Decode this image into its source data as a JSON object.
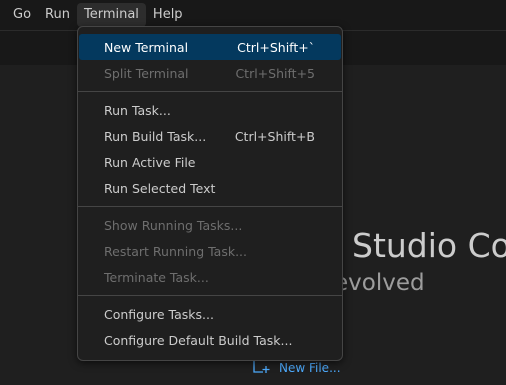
{
  "menubar": {
    "items": [
      {
        "label": "Go",
        "active": false
      },
      {
        "label": "Run",
        "active": false
      },
      {
        "label": "Terminal",
        "active": true
      },
      {
        "label": "Help",
        "active": false
      }
    ]
  },
  "background": {
    "title": "Studio Coc",
    "subtitle": "evolved",
    "new_file_label": "New File..."
  },
  "terminal_menu": {
    "groups": [
      [
        {
          "label": "New Terminal",
          "shortcut": "Ctrl+Shift+`",
          "enabled": true,
          "highlighted": true
        },
        {
          "label": "Split Terminal",
          "shortcut": "Ctrl+Shift+5",
          "enabled": false,
          "highlighted": false
        }
      ],
      [
        {
          "label": "Run Task...",
          "shortcut": "",
          "enabled": true,
          "highlighted": false
        },
        {
          "label": "Run Build Task...",
          "shortcut": "Ctrl+Shift+B",
          "enabled": true,
          "highlighted": false
        },
        {
          "label": "Run Active File",
          "shortcut": "",
          "enabled": true,
          "highlighted": false
        },
        {
          "label": "Run Selected Text",
          "shortcut": "",
          "enabled": true,
          "highlighted": false
        }
      ],
      [
        {
          "label": "Show Running Tasks...",
          "shortcut": "",
          "enabled": false,
          "highlighted": false
        },
        {
          "label": "Restart Running Task...",
          "shortcut": "",
          "enabled": false,
          "highlighted": false
        },
        {
          "label": "Terminate Task...",
          "shortcut": "",
          "enabled": false,
          "highlighted": false
        }
      ],
      [
        {
          "label": "Configure Tasks...",
          "shortcut": "",
          "enabled": true,
          "highlighted": false
        },
        {
          "label": "Configure Default Build Task...",
          "shortcut": "",
          "enabled": true,
          "highlighted": false
        }
      ]
    ]
  },
  "colors": {
    "accent": "#04395e",
    "link": "#4daafc",
    "background": "#1f1f1f"
  }
}
